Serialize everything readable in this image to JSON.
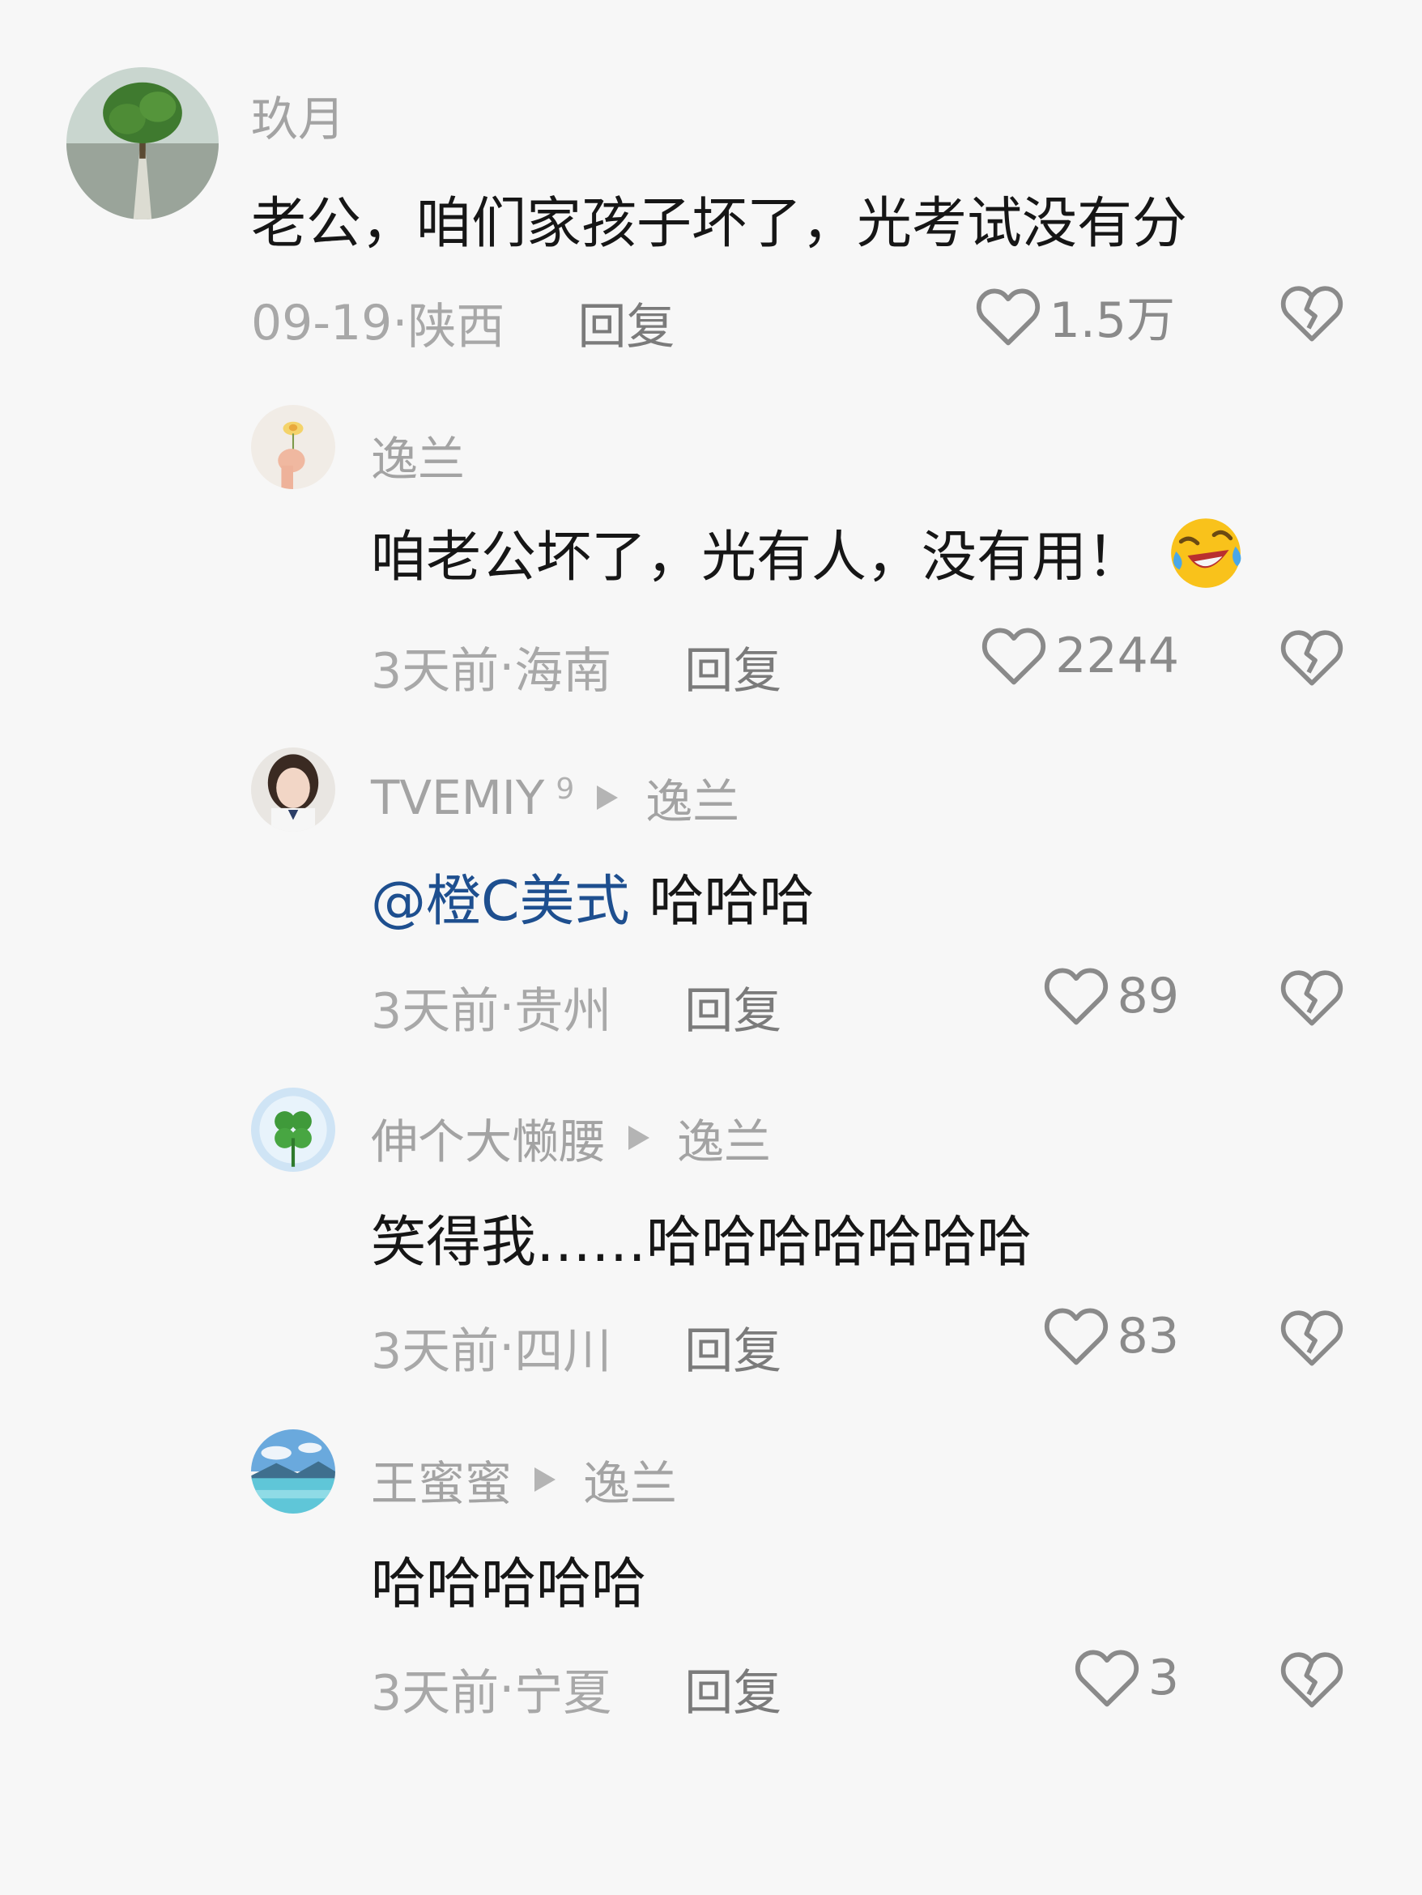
{
  "comments": [
    {
      "name": "玖月",
      "content": "老公，咱们家孩子坏了，光考试没有分",
      "date": "09-19",
      "sep": " · ",
      "location": "陕西",
      "reply_label": "回复",
      "likes": "1.5万",
      "avatar_icon": "tree-avatar"
    },
    {
      "name": "逸兰",
      "content": "咱老公坏了，光有人，没有用！",
      "emoji_icon": "laughing-crying-emoji",
      "date": "3天前",
      "sep": " · ",
      "location": "海南",
      "reply_label": "回复",
      "likes": "2244",
      "avatar_icon": "flower-hand-avatar"
    },
    {
      "name": "TVEMIY",
      "badge": "9",
      "reply_to": "逸兰",
      "mention": "@橙C美式",
      "content": "哈哈哈",
      "date": "3天前",
      "sep": " · ",
      "location": "贵州",
      "reply_label": "回复",
      "likes": "89",
      "avatar_icon": "girl-avatar"
    },
    {
      "name": "伸个大懒腰",
      "reply_to": "逸兰",
      "content": "笑得我……哈哈哈哈哈哈哈",
      "date": "3天前",
      "sep": " · ",
      "location": "四川",
      "reply_label": "回复",
      "likes": "83",
      "avatar_icon": "clover-avatar"
    },
    {
      "name": "王蜜蜜",
      "reply_to": "逸兰",
      "content": "哈哈哈哈哈",
      "date": "3天前",
      "sep": " · ",
      "location": "宁夏",
      "reply_label": "回复",
      "likes": "3",
      "avatar_icon": "lake-avatar"
    }
  ],
  "colors": {
    "background": "#f7f7f7",
    "mention": "#1e4f8f",
    "text": "#161616",
    "muted": "#a8a8a8"
  }
}
